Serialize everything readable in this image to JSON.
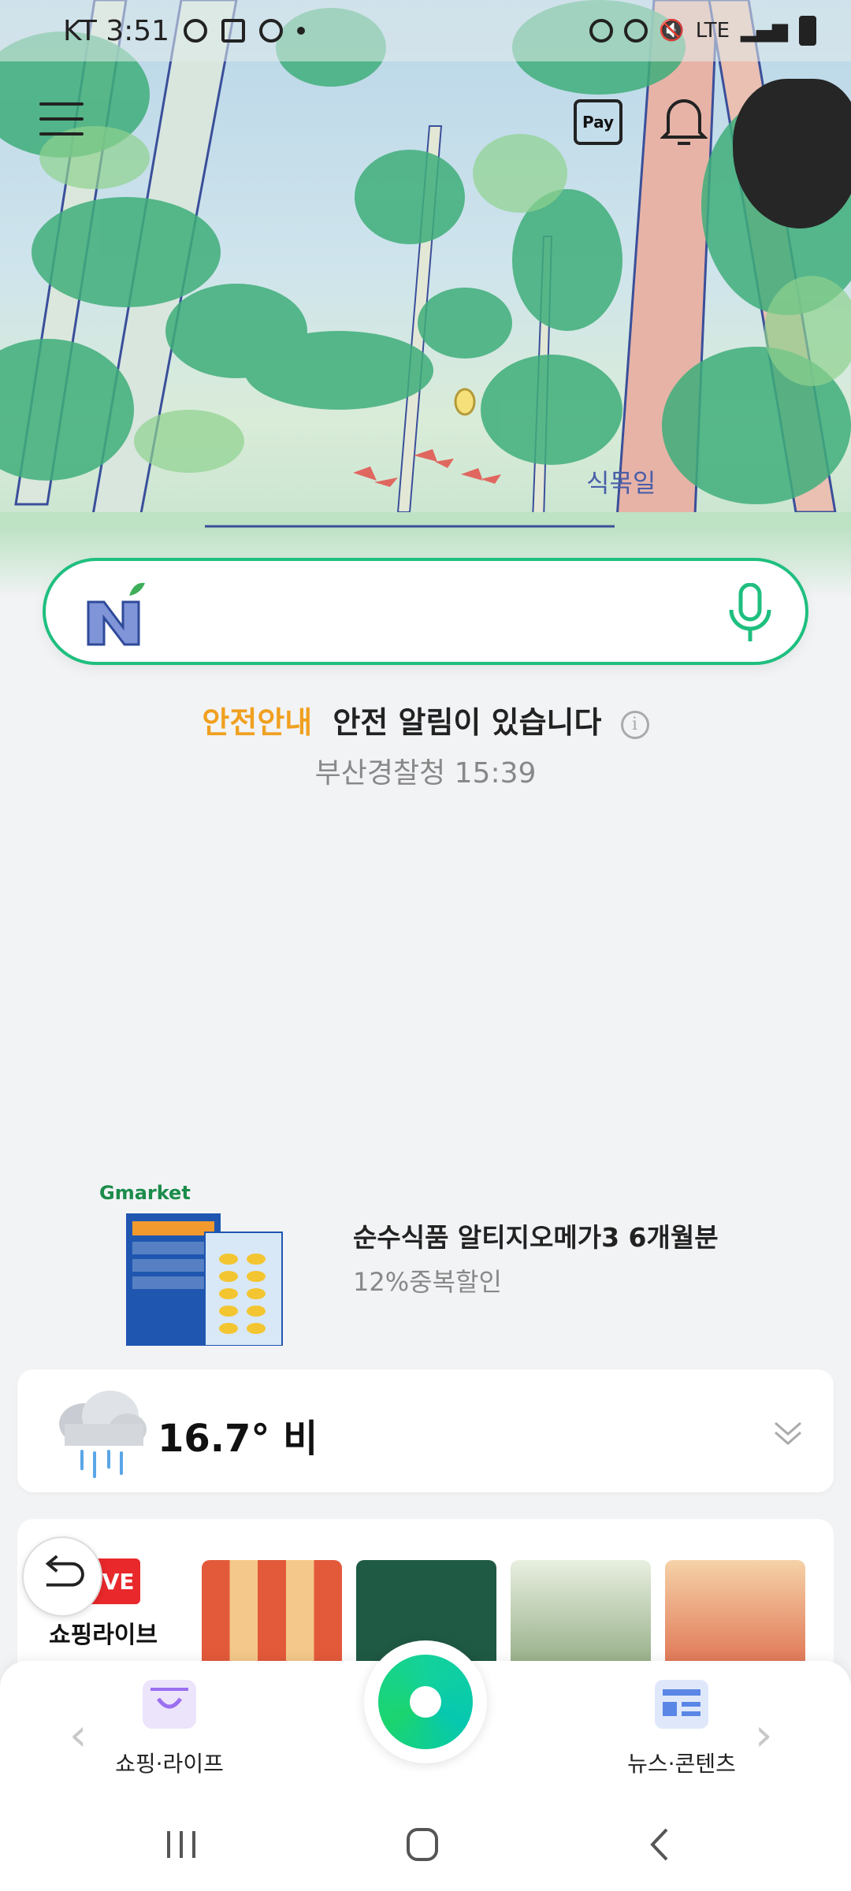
{
  "status_bar": {
    "carrier_time": "KT 3:51",
    "network": "LTE"
  },
  "header": {
    "pay_label": "Pay"
  },
  "hero": {
    "caption": "식목일"
  },
  "search": {
    "placeholder": ""
  },
  "notice": {
    "tag": "안전안내",
    "message": "안전 알림이 있습니다",
    "source_time": "부산경찰청 15:39"
  },
  "ad": {
    "brand": "Gmarket",
    "title": "순수식품 알티지오메가3 6개월분",
    "subtitle": "12%중복할인"
  },
  "weather": {
    "summary": "16.7° 비"
  },
  "shopping_live": {
    "logo_text": "LIVE",
    "label": "쇼핑라이브"
  },
  "dock": {
    "left_label": "쇼핑·라이프",
    "right_label": "뉴스·콘텐츠",
    "prev_arrow": "‹",
    "next_arrow": "›"
  },
  "colors": {
    "brand_green": "#1fbf7f",
    "notice_orange": "#f0a020",
    "live_red": "#e8282b"
  }
}
